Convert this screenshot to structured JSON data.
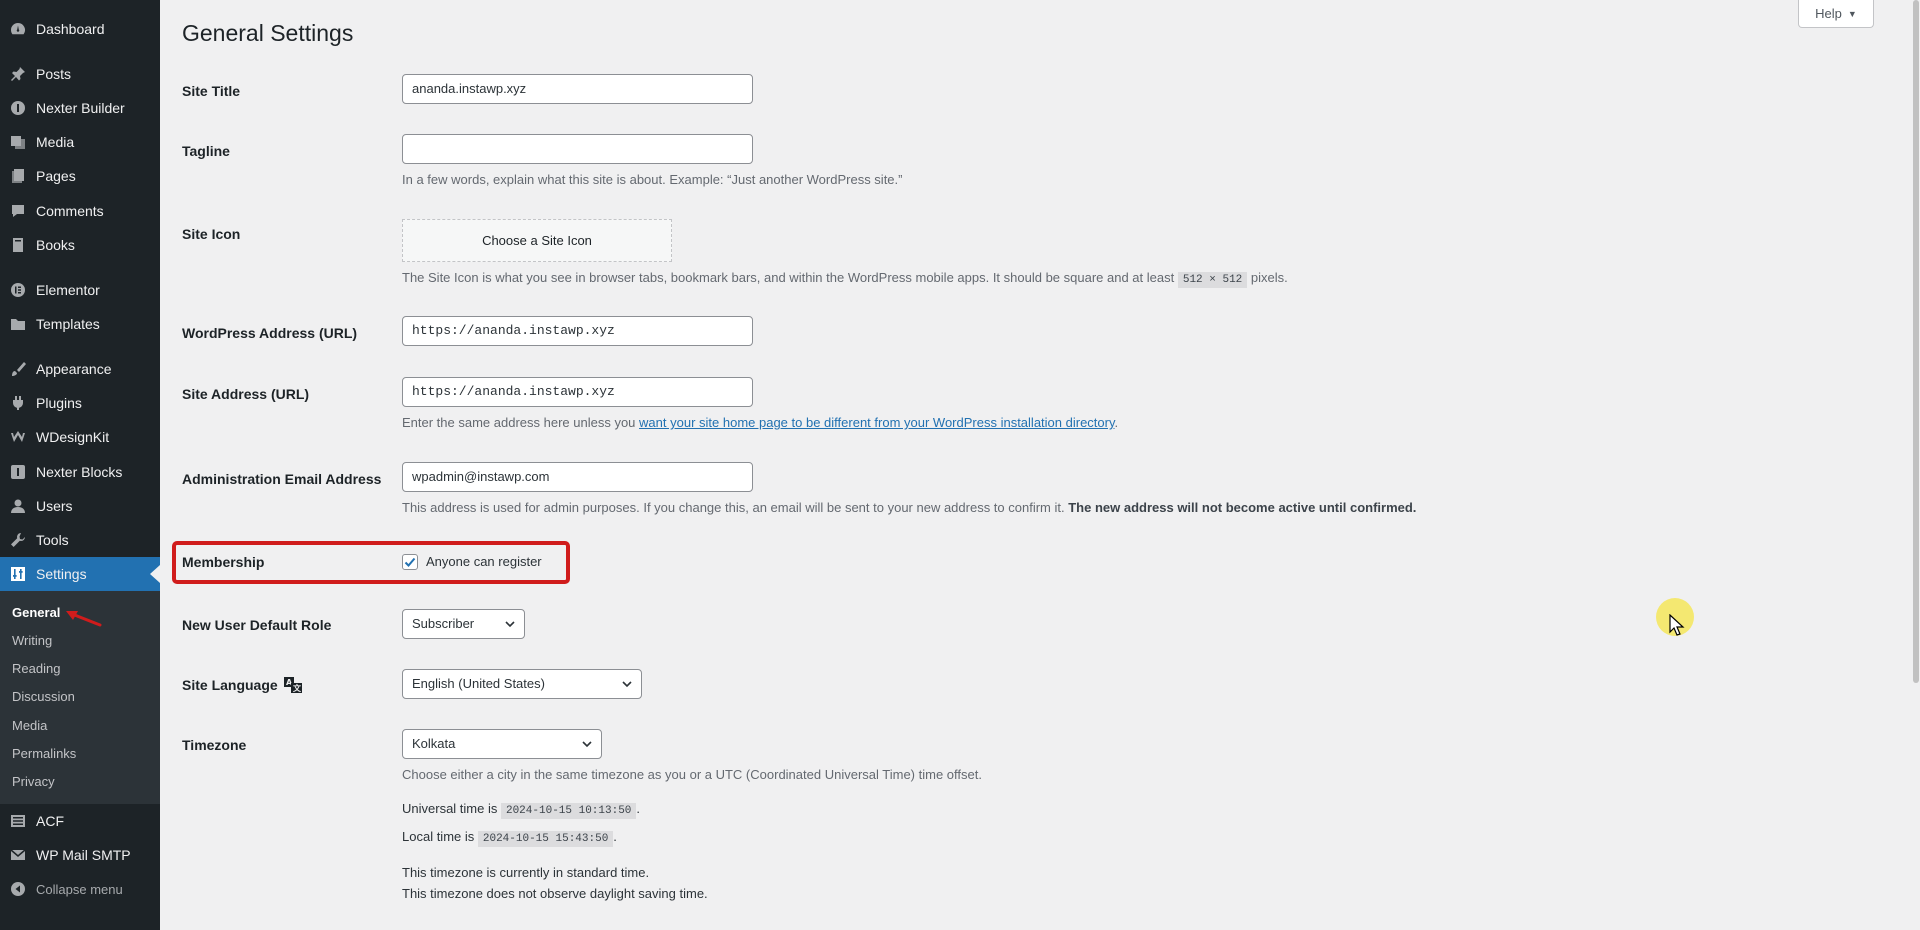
{
  "sidebar": {
    "items": [
      {
        "label": "Dashboard",
        "icon": "dashboard-icon"
      },
      {
        "label": "Posts",
        "icon": "pin-icon"
      },
      {
        "label": "Nexter Builder",
        "icon": "nexter-builder-icon"
      },
      {
        "label": "Media",
        "icon": "media-icon"
      },
      {
        "label": "Pages",
        "icon": "pages-icon"
      },
      {
        "label": "Comments",
        "icon": "comment-icon"
      },
      {
        "label": "Books",
        "icon": "books-icon"
      },
      {
        "label": "Elementor",
        "icon": "elementor-icon"
      },
      {
        "label": "Templates",
        "icon": "folder-icon"
      },
      {
        "label": "Appearance",
        "icon": "brush-icon"
      },
      {
        "label": "Plugins",
        "icon": "plugin-icon"
      },
      {
        "label": "WDesignKit",
        "icon": "wdesignkit-icon"
      },
      {
        "label": "Nexter Blocks",
        "icon": "nexter-blocks-icon"
      },
      {
        "label": "Users",
        "icon": "user-icon"
      },
      {
        "label": "Tools",
        "icon": "wrench-icon"
      },
      {
        "label": "Settings",
        "icon": "settings-icon"
      }
    ],
    "settings_submenu": [
      "General",
      "Writing",
      "Reading",
      "Discussion",
      "Media",
      "Permalinks",
      "Privacy"
    ],
    "bottom_items": [
      {
        "label": "ACF",
        "icon": "acf-icon"
      },
      {
        "label": "WP Mail SMTP",
        "icon": "mail-icon"
      }
    ],
    "collapse_label": "Collapse menu"
  },
  "header": {
    "title": "General Settings",
    "help_label": "Help"
  },
  "form": {
    "site_title": {
      "label": "Site Title",
      "value": "ananda.instawp.xyz"
    },
    "tagline": {
      "label": "Tagline",
      "value": "",
      "description": "In a few words, explain what this site is about. Example: “Just another WordPress site.”"
    },
    "site_icon": {
      "label": "Site Icon",
      "button": "Choose a Site Icon",
      "desc_before": "The Site Icon is what you see in browser tabs, bookmark bars, and within the WordPress mobile apps. It should be square and at least",
      "desc_code": "512 × 512",
      "desc_after": "pixels."
    },
    "wp_address": {
      "label": "WordPress Address (URL)",
      "value": "https://ananda.instawp.xyz"
    },
    "site_address": {
      "label": "Site Address (URL)",
      "value": "https://ananda.instawp.xyz",
      "desc_before": "Enter the same address here unless you",
      "desc_link": "want your site home page to be different from your WordPress installation directory",
      "desc_after": "."
    },
    "admin_email": {
      "label": "Administration Email Address",
      "value": "wpadmin@instawp.com",
      "desc_before": "This address is used for admin purposes. If you change this, an email will be sent to your new address to confirm it.",
      "desc_strong": "The new address will not become active until confirmed."
    },
    "membership": {
      "label": "Membership",
      "checkbox_label": "Anyone can register",
      "checked": true
    },
    "default_role": {
      "label": "New User Default Role",
      "value": "Subscriber"
    },
    "site_language": {
      "label": "Site Language",
      "value": "English (United States)"
    },
    "timezone": {
      "label": "Timezone",
      "value": "Kolkata",
      "description": "Choose either a city in the same timezone as you or a UTC (Coordinated Universal Time) time offset.",
      "universal_label": "Universal time is",
      "universal_value": "2024-10-15 10:13:50",
      "local_label": "Local time is",
      "local_value": "2024-10-15 15:43:50",
      "standard_note": "This timezone is currently in standard time.",
      "dst_note": "This timezone does not observe daylight saving time."
    }
  },
  "colors": {
    "sidebar_bg": "#1d2327",
    "accent": "#2271b1",
    "highlight": "#d01c1c"
  }
}
